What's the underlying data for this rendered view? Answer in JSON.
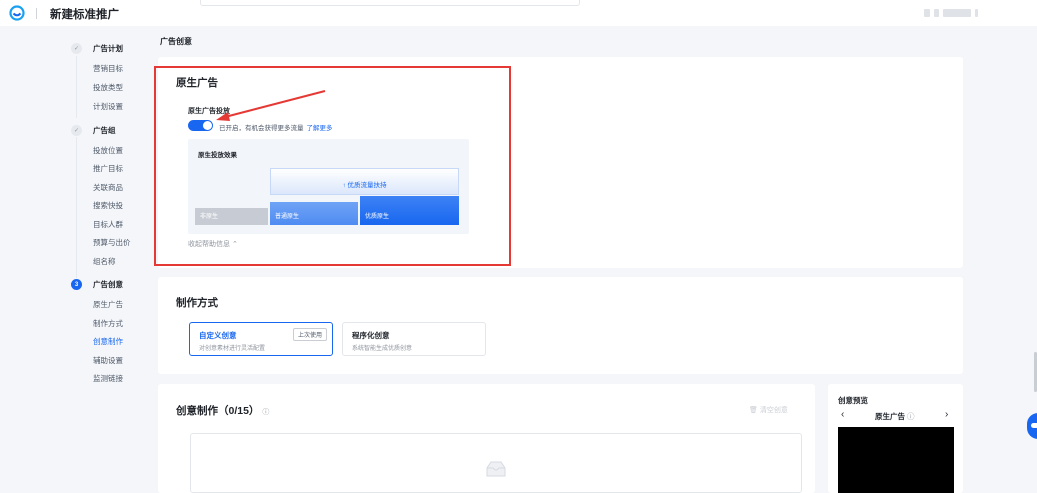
{
  "app": {
    "title": "新建标准推广"
  },
  "sidebar": {
    "steps": [
      {
        "marker": "✓",
        "label": "广告计划",
        "items": [
          "营销目标",
          "投放类型",
          "计划设置"
        ]
      },
      {
        "marker": "✓",
        "label": "广告组",
        "items": [
          "投放位置",
          "推广目标",
          "关联商品",
          "搜索快投",
          "目标人群",
          "预算与出价",
          "组名称"
        ]
      },
      {
        "marker": "3",
        "label": "广告创意",
        "items": [
          "原生广告",
          "制作方式",
          "创意制作",
          "辅助设置",
          "监测链接"
        ],
        "current_item": "创意制作"
      }
    ]
  },
  "main": {
    "section_title": "广告创意",
    "native_ad": {
      "title": "原生广告",
      "toggle_label": "原生广告投放",
      "toggle_on": true,
      "toggle_desc": "已开启，有机会获得更多流量",
      "learn_more": "了解更多",
      "effect_title": "原生投放效果",
      "boost_label": "↑ 优质流量扶持",
      "bars": [
        "非原生",
        "普通原生",
        "优质原生"
      ],
      "collapse_help": "收起帮助信息 ⌃"
    },
    "production": {
      "title": "制作方式",
      "options": [
        {
          "title": "自定义创意",
          "desc": "对创意素材进行灵活配置",
          "badge": "上次使用",
          "selected": true
        },
        {
          "title": "程序化创意",
          "desc": "系统智能生成优质创意",
          "selected": false
        }
      ]
    },
    "creative": {
      "title": "创意制作（0/15）",
      "help_icon": "ⓘ",
      "clear_label": "🗑 清空创意"
    },
    "preview": {
      "title": "创意预览",
      "prev": "‹",
      "next": "›",
      "name": "原生广告",
      "help_icon": "ⓘ"
    }
  },
  "colors": {
    "accent": "#1967f0",
    "highlight": "#e53935",
    "page_bg": "#f4f6f9"
  }
}
